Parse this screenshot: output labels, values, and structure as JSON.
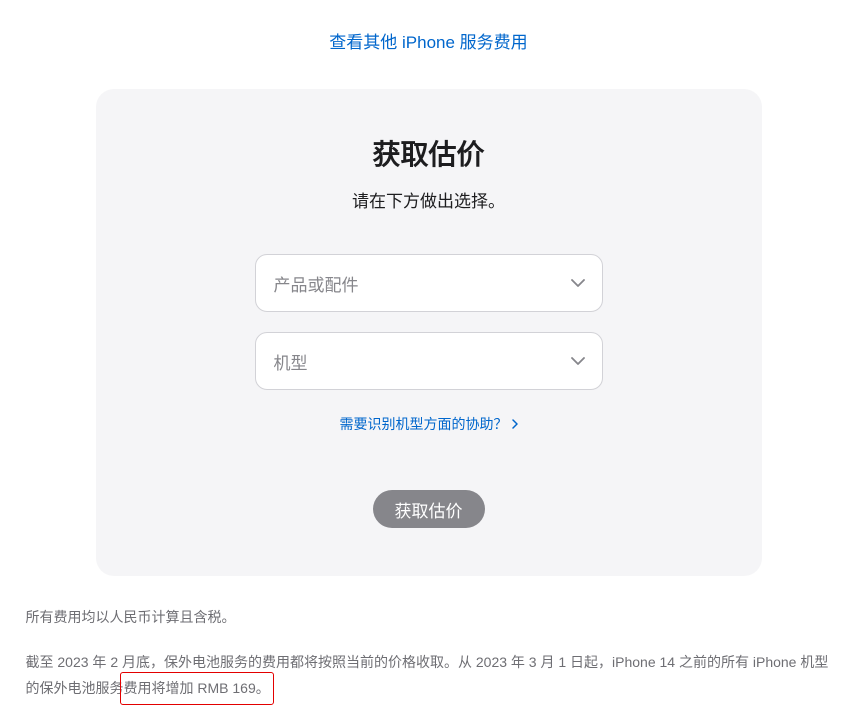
{
  "topLink": "查看其他 iPhone 服务费用",
  "card": {
    "title": "获取估价",
    "subtitle": "请在下方做出选择。",
    "select1Placeholder": "产品或配件",
    "select2Placeholder": "机型",
    "helpLink": "需要识别机型方面的协助？",
    "submitLabel": "获取估价"
  },
  "footnote1": "所有费用均以人民币计算且含税。",
  "footnote2Part1": "截至 2023 年 2 月底，保外电池服务的费用都将按照当前的价格收取。从 2023 年 3 月 1 日起，iPhone 14 之前的所有 iPhone 机型的保外电池服务",
  "footnote2Highlight": "费用将增加 RMB 169。"
}
